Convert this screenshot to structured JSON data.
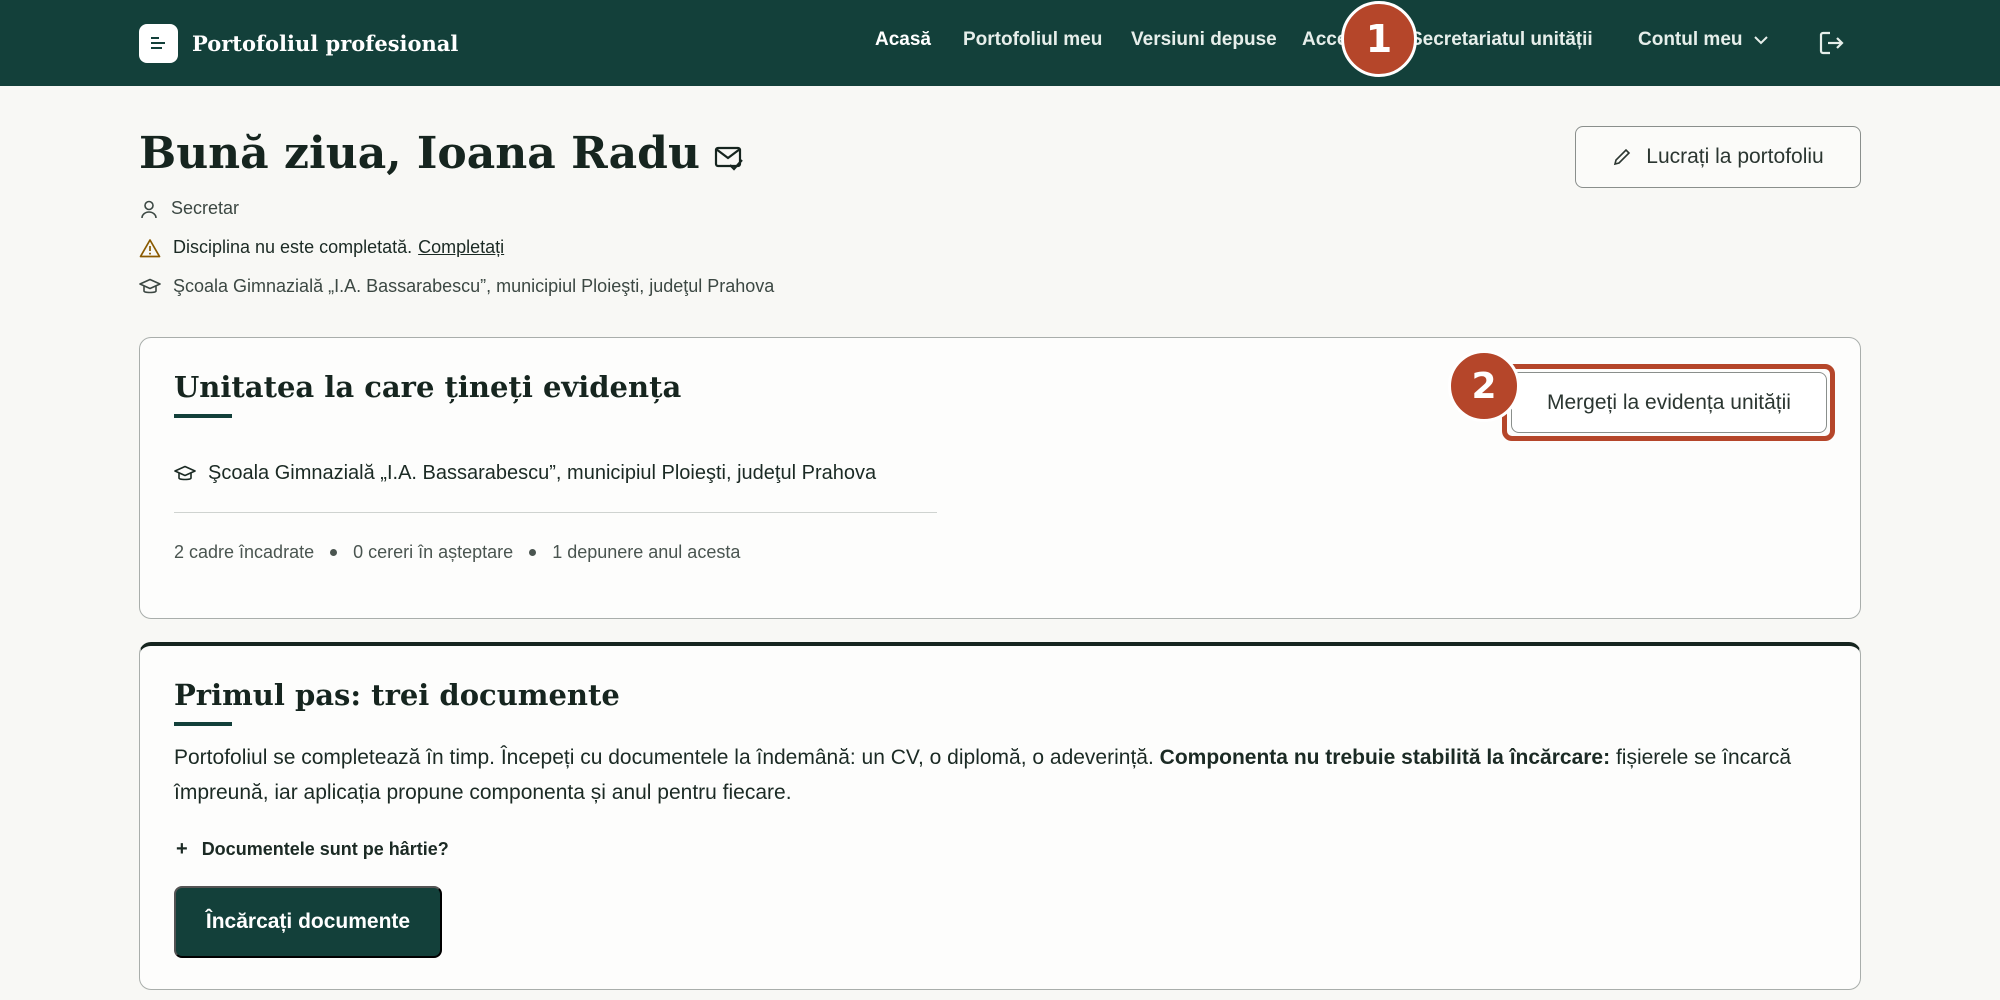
{
  "header": {
    "brand": "Portofoliul profesional",
    "nav": [
      {
        "label": "Acasă",
        "active": true
      },
      {
        "label": "Portofoliul meu"
      },
      {
        "label": "Versiuni depuse"
      },
      {
        "label": "Acce"
      },
      {
        "label": "Secretariatul unității"
      }
    ],
    "account_label": "Contul meu",
    "icons": [
      "document-logo-icon",
      "chevron-down-icon",
      "logout-icon"
    ]
  },
  "badges": [
    "1",
    "2"
  ],
  "profile": {
    "greeting": "Bună ziua, Ioana Radu",
    "role": "Secretar",
    "warning_text": "Disciplina nu este completată.",
    "warning_link": "Completați",
    "school": "Şcoala Gimnazială „I.A. Bassarabescu”, municipiul Ploieşti, judeţul Prahova",
    "work_button": "Lucrați la portofoliu"
  },
  "unit_card": {
    "title": "Unitatea la care țineți evidența",
    "go_button": "Mergeți la evidența unității",
    "school": "Şcoala Gimnazială „I.A. Bassarabescu”, municipiul Ploieşti, judeţul Prahova",
    "stats": [
      "2 cadre încadrate",
      "0 cereri în așteptare",
      "1 depunere anul acesta"
    ]
  },
  "docs_card": {
    "title": "Primul pas: trei documente",
    "text_intro": "Portofoliul se completează în timp. Începeți cu documentele la îndemână: un CV, o diplomă, o adeverință.",
    "text_bold": "Componenta nu trebuie stabilită la încărcare:",
    "text_rest": "fișierele se încarcă împreună, iar aplicația propune componenta și anul pentru fiecare.",
    "paper_toggle": "Documentele sunt pe hârtie?",
    "upload_button": "Încărcați documente"
  },
  "colors": {
    "primary": "#13403a",
    "highlight": "#b5462a",
    "background": "#f8f8f5"
  }
}
